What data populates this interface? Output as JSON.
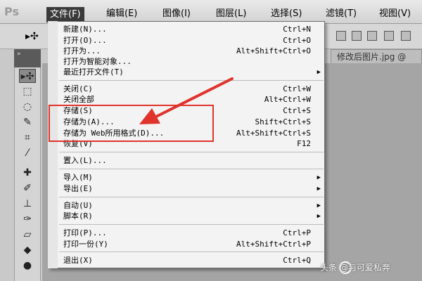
{
  "app": {
    "logo": "Ps"
  },
  "menubar": {
    "items": [
      {
        "label": "文件(F)",
        "active": true
      },
      {
        "label": "编辑(E)"
      },
      {
        "label": "图像(I)"
      },
      {
        "label": "图层(L)"
      },
      {
        "label": "选择(S)"
      },
      {
        "label": "滤镜(T)"
      },
      {
        "label": "视图(V)"
      }
    ]
  },
  "document": {
    "tab_label": "修改后图片.jpg @"
  },
  "file_menu": {
    "items": [
      {
        "label": "新建(N)...",
        "shortcut": "Ctrl+N"
      },
      {
        "label": "打开(O)...",
        "shortcut": "Ctrl+O"
      },
      {
        "label": "打开为...",
        "shortcut": "Alt+Shift+Ctrl+O"
      },
      {
        "label": "打开为智能对象..."
      },
      {
        "label": "最近打开文件(T)",
        "submenu": true
      },
      {
        "label": "关闭(C)",
        "shortcut": "Ctrl+W"
      },
      {
        "label": "关闭全部",
        "shortcut": "Alt+Ctrl+W"
      },
      {
        "label": "存储(S)",
        "shortcut": "Ctrl+S"
      },
      {
        "label": "存储为(A)...",
        "shortcut": "Shift+Ctrl+S"
      },
      {
        "label": "存储为 Web所用格式(D)...",
        "shortcut": "Alt+Shift+Ctrl+S"
      },
      {
        "label": "恢复(V)",
        "shortcut": "F12"
      },
      {
        "label": "置入(L)..."
      },
      {
        "label": "导入(M)",
        "submenu": true
      },
      {
        "label": "导出(E)",
        "submenu": true
      },
      {
        "label": "自动(U)",
        "submenu": true
      },
      {
        "label": "脚本(R)",
        "submenu": true
      },
      {
        "label": "打印(P)...",
        "shortcut": "Ctrl+P"
      },
      {
        "label": "打印一份(Y)",
        "shortcut": "Alt+Shift+Ctrl+P"
      },
      {
        "label": "退出(X)",
        "shortcut": "Ctrl+Q"
      }
    ],
    "submenu_arrow": "▶"
  },
  "toolbox": {
    "header": "»",
    "tools": [
      "move-icon",
      "marquee-icon",
      "lasso-icon",
      "quick-select-icon",
      "crop-icon",
      "eyedropper-icon",
      "healing-brush-icon",
      "brush-icon",
      "clone-stamp-icon",
      "history-brush-icon",
      "eraser-icon",
      "paint-bucket-icon",
      "dodge-icon"
    ]
  },
  "watermark": {
    "text": "头条 @与可爱私奔"
  },
  "colors": {
    "annotation": "#e0332b",
    "menu_active_bg": "#3a3a3a"
  }
}
